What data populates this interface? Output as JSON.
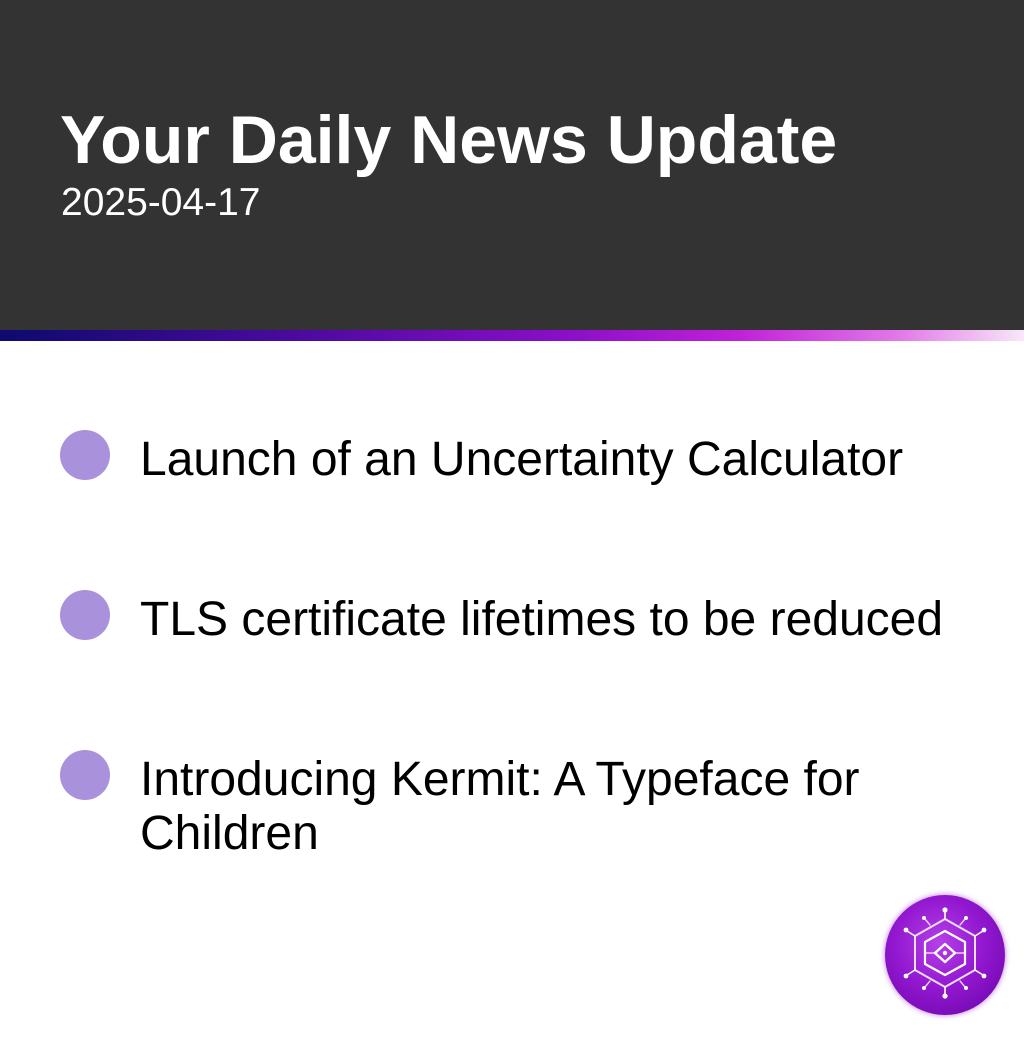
{
  "header": {
    "title": "Your Daily News Update",
    "date": "2025-04-17"
  },
  "news": {
    "items": [
      {
        "text": "Launch of an Uncertainty Calculator"
      },
      {
        "text": "TLS certificate lifetimes to be reduced"
      },
      {
        "text": "Introducing Kermit: A Typeface for Children"
      }
    ]
  },
  "colors": {
    "header_bg": "#333333",
    "bullet": "#a991db",
    "accent_start": "#0d0a6e",
    "accent_mid": "#8a0ec8",
    "accent_end": "#f8e8f8",
    "logo": "#9318d0"
  },
  "logo": {
    "icon": "circuit-hexagon-icon"
  }
}
